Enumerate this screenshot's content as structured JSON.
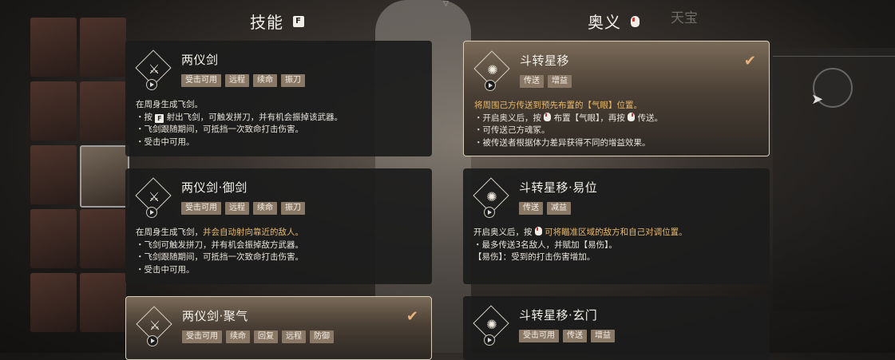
{
  "headers": {
    "skills": {
      "title": "技能",
      "key": "F"
    },
    "ultimate": {
      "title": "奥义"
    },
    "tab_right": "天宝"
  },
  "skills": [
    {
      "title": "两仪剑",
      "tags": [
        "受击可用",
        "远程",
        "续命",
        "振刀"
      ],
      "selected": false,
      "icon": "sword-spin-icon",
      "lines": [
        {
          "parts": [
            {
              "t": "在周身生成飞剑。"
            }
          ]
        },
        {
          "parts": [
            {
              "t": "・按 "
            },
            {
              "k": "F"
            },
            {
              "t": " 射出飞剑，可触发拼刀，并有机会振掉该武器。"
            }
          ]
        },
        {
          "parts": [
            {
              "t": "・飞剑跟随期间，可抵挡一次致命打击伤害。"
            }
          ]
        },
        {
          "parts": [
            {
              "t": "・受击中可用。"
            }
          ]
        }
      ]
    },
    {
      "title": "两仪剑·御剑",
      "tags": [
        "受击可用",
        "远程",
        "续命",
        "振刀"
      ],
      "selected": false,
      "icon": "sword-volley-icon",
      "lines": [
        {
          "parts": [
            {
              "t": "在周身生成飞剑，"
            },
            {
              "h": "并会自动射向靠近的敌人。"
            }
          ]
        },
        {
          "parts": [
            {
              "t": "・飞剑可触发拼刀，并有机会振掉敌方武器。"
            }
          ]
        },
        {
          "parts": [
            {
              "t": "・飞剑跟随期间，可抵挡一次致命打击伤害。"
            }
          ]
        },
        {
          "parts": [
            {
              "t": "・受击中可用。"
            }
          ]
        }
      ]
    },
    {
      "title": "两仪剑·聚气",
      "tags": [
        "受击可用",
        "续命",
        "回复",
        "远程",
        "防御"
      ],
      "selected": true,
      "icon": "sword-gather-icon",
      "lines": []
    }
  ],
  "ultimates": [
    {
      "title": "斗转星移",
      "tags": [
        "传送",
        "增益"
      ],
      "selected": true,
      "icon": "swirl-icon",
      "lines": [
        {
          "parts": [
            {
              "h": "将周围己方传送到预先布置的【气眼】位置。"
            }
          ]
        },
        {
          "parts": [
            {
              "t": "・开启奥义后，按 "
            },
            {
              "m": "left"
            },
            {
              "t": " 布置【气眼】，再按 "
            },
            {
              "m": "right"
            },
            {
              "t": " 传送。"
            }
          ]
        },
        {
          "parts": [
            {
              "t": "・可传送己方魂冢。"
            }
          ]
        },
        {
          "parts": [
            {
              "t": "・被传送者根据体力差异获得不同的增益效果。"
            }
          ]
        }
      ]
    },
    {
      "title": "斗转星移·易位",
      "tags": [
        "传送",
        "减益"
      ],
      "selected": false,
      "icon": "swirl-swap-icon",
      "lines": [
        {
          "parts": [
            {
              "t": "开启奥义后，按 "
            },
            {
              "m": "left"
            },
            {
              "h": " 可将瞄准区域的敌方和自己对调位置。"
            }
          ]
        },
        {
          "parts": [
            {
              "t": "・最多传送3名敌人，并赋加【易伤】。"
            }
          ]
        },
        {
          "parts": [
            {
              "t": "【易伤】：受到的打击伤害增加。"
            }
          ]
        }
      ]
    },
    {
      "title": "斗转星移·玄门",
      "tags": [
        "受击可用",
        "传送",
        "增益"
      ],
      "selected": false,
      "icon": "swirl-gate-icon",
      "lines": []
    }
  ]
}
